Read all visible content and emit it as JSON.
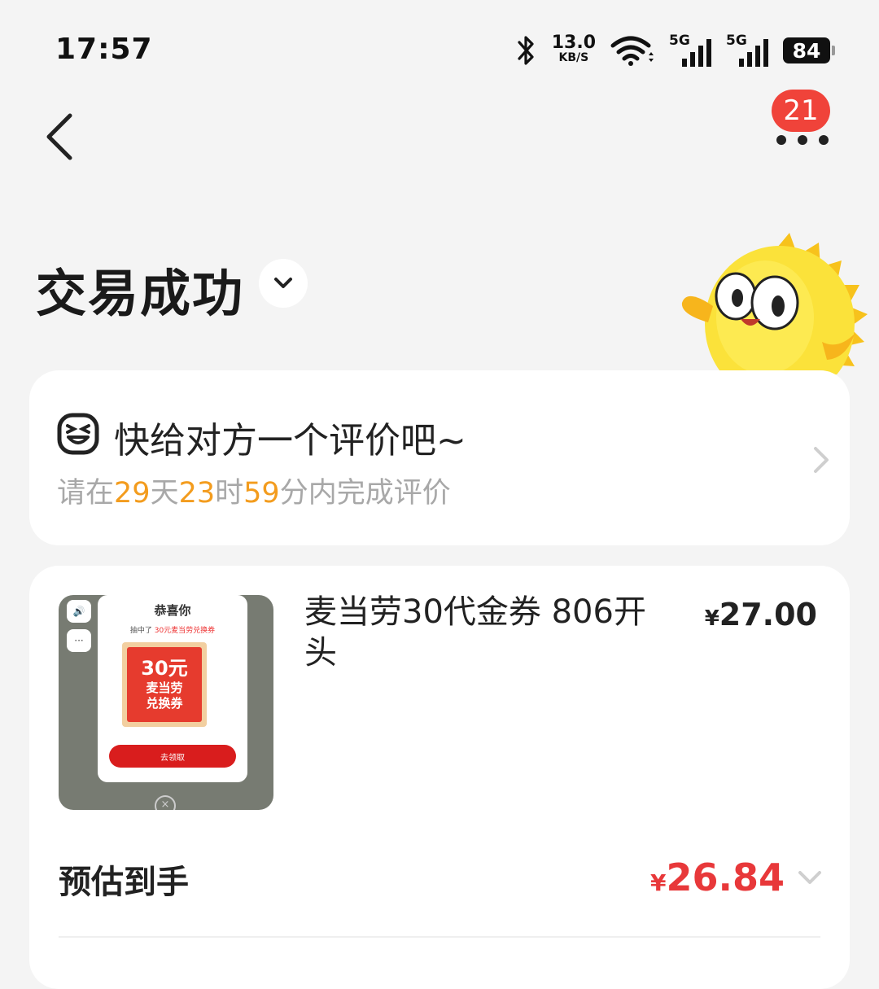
{
  "status_bar": {
    "time": "17:57",
    "net_speed_value": "13.0",
    "net_speed_unit": "KB/S",
    "sim1_label": "5G",
    "sim2_label": "5G",
    "battery": "84",
    "icons": [
      "bluetooth-icon",
      "wifi-icon",
      "signal-icon",
      "battery-icon"
    ]
  },
  "nav": {
    "back_icon": "chevron-left-icon",
    "more_icon": "more-dots-icon",
    "message_badge": "21"
  },
  "order_status": {
    "title": "交易成功"
  },
  "review_prompt": {
    "title": "快给对方一个评价吧~",
    "sub_prefix": "请在",
    "days": "29",
    "days_unit": "天",
    "hours": "23",
    "hours_unit": "时",
    "minutes": "59",
    "minutes_unit": "分内完成评价",
    "highlight_color": "#f39c1e"
  },
  "item": {
    "name": "麦当劳30代金券 806开头",
    "price_currency": "¥",
    "price": "27.00",
    "thumbnail": {
      "popup_title": "恭喜你",
      "popup_sub_prefix": "抽中了",
      "popup_sub_highlight": "30元麦当劳兑换券",
      "coupon_amount": "30元",
      "coupon_line1": "麦当劳",
      "coupon_line2": "兑换券",
      "claim_button": "去领取"
    }
  },
  "estimated": {
    "label": "预估到手",
    "currency": "¥",
    "value": "26.84",
    "accent_color": "#e8383a"
  }
}
